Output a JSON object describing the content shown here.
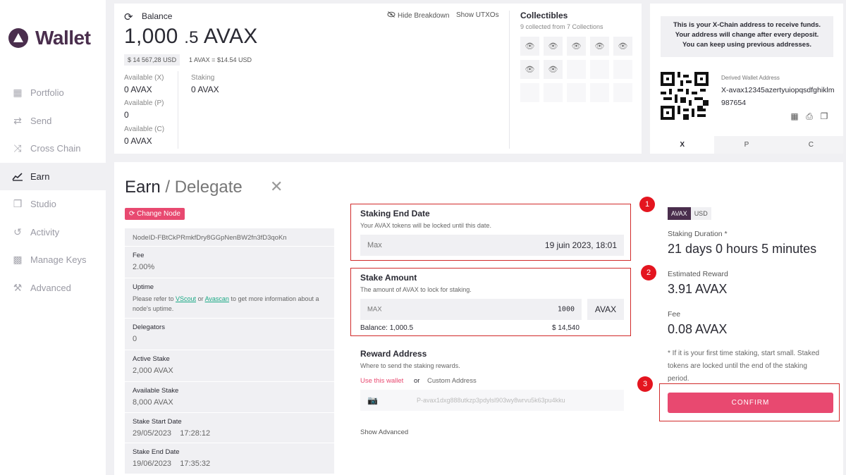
{
  "sidebar": {
    "logo": "Wallet",
    "items": [
      {
        "label": "Portfolio",
        "icon": "grid-icon"
      },
      {
        "label": "Send",
        "icon": "swap-arrows-icon"
      },
      {
        "label": "Cross Chain",
        "icon": "shuffle-icon"
      },
      {
        "label": "Earn",
        "icon": "chart-line-icon",
        "active": true
      },
      {
        "label": "Studio",
        "icon": "cube-icon"
      },
      {
        "label": "Activity",
        "icon": "history-icon"
      },
      {
        "label": "Manage Keys",
        "icon": "keys-icon"
      },
      {
        "label": "Advanced",
        "icon": "wrench-icon"
      }
    ]
  },
  "balance": {
    "label": "Balance",
    "hide_breakdown": "Hide Breakdown",
    "show_utxos": "Show UTXOs",
    "amount_int": "1,000",
    "amount_dec": ".5",
    "unit": "AVAX",
    "usd": "$ 14 567,28",
    "usd_unit": "USD",
    "rate": "1 AVAX = $14.54",
    "rate_unit": "USD",
    "available_x_label": "Available (X)",
    "available_x": "0 AVAX",
    "available_p_label": "Available (P)",
    "available_p": "0",
    "available_c_label": "Available (C)",
    "available_c": "0 AVAX",
    "staking_label": "Staking",
    "staking": "0 AVAX"
  },
  "collectibles": {
    "title": "Collectibles",
    "subtitle": "9 collected from 7 Collections"
  },
  "address": {
    "note_line1": "This is your X-Chain address to receive funds.",
    "note_line2": "Your address will change after every deposit.",
    "note_line3": "You can keep using previous addresses.",
    "derived_label": "Derived Wallet Address",
    "derived_value": "X-avax12345azertyuiopqsdfghiklm987654",
    "tabs": [
      "X",
      "P",
      "C"
    ]
  },
  "earn": {
    "title": "Earn",
    "subtitle": "/ Delegate",
    "close": "✕",
    "change_node": "Change Node",
    "node": {
      "node_id": "NodeID-FBtCkPRmkfDry8GGpNenBW2fn3fD3qoKn",
      "fee_label": "Fee",
      "fee": "2.00%",
      "uptime_label": "Uptime",
      "uptime_pre": "Please refer to ",
      "uptime_link1": "VScout",
      "uptime_mid": " or ",
      "uptime_link2": "Avascan",
      "uptime_post": " to get more information about a node's uptime.",
      "delegators_label": "Delegators",
      "delegators": "0",
      "active_stake_label": "Active Stake",
      "active_stake": "2,000 AVAX",
      "available_stake_label": "Available Stake",
      "available_stake": "8,000 AVAX",
      "start_label": "Stake Start Date",
      "start_date": "29/05/2023",
      "start_time": "17:28:12",
      "end_label": "Stake End Date",
      "end_date": "19/06/2023",
      "end_time": "17:35:32"
    },
    "end_date": {
      "title": "Staking End Date",
      "sub": "Your AVAX tokens will be locked until this date.",
      "max": "Max",
      "value": "19 juin 2023, 18:01"
    },
    "amount": {
      "title": "Stake Amount",
      "sub": "The amount of AVAX to lock for staking.",
      "max": "MAX",
      "value": "1000",
      "unit": "AVAX",
      "balance": "Balance: 1,000.5",
      "usd": "$ 14,540"
    },
    "reward": {
      "title": "Reward Address",
      "sub": "Where to send the staking rewards.",
      "use_wallet": "Use this wallet",
      "or": "or",
      "custom": "Custom Address",
      "placeholder": "P-avax1dxg888utkzp3pdylsl903wy8wrvu5k63pu4kku"
    },
    "show_advanced": "Show Advanced",
    "summary": {
      "toggle_on": "AVAX",
      "toggle_off": "USD",
      "duration_label": "Staking Duration *",
      "duration": "21 days 0 hours 5 minutes",
      "reward_label": "Estimated Reward",
      "reward": "3.91 AVAX",
      "fee_label": "Fee",
      "fee": "0.08 AVAX",
      "note": "* If it is your first time staking, start small. Staked tokens are locked until the end of the staking period.",
      "confirm": "CONFIRM"
    },
    "badges": [
      "1",
      "2",
      "3"
    ]
  }
}
